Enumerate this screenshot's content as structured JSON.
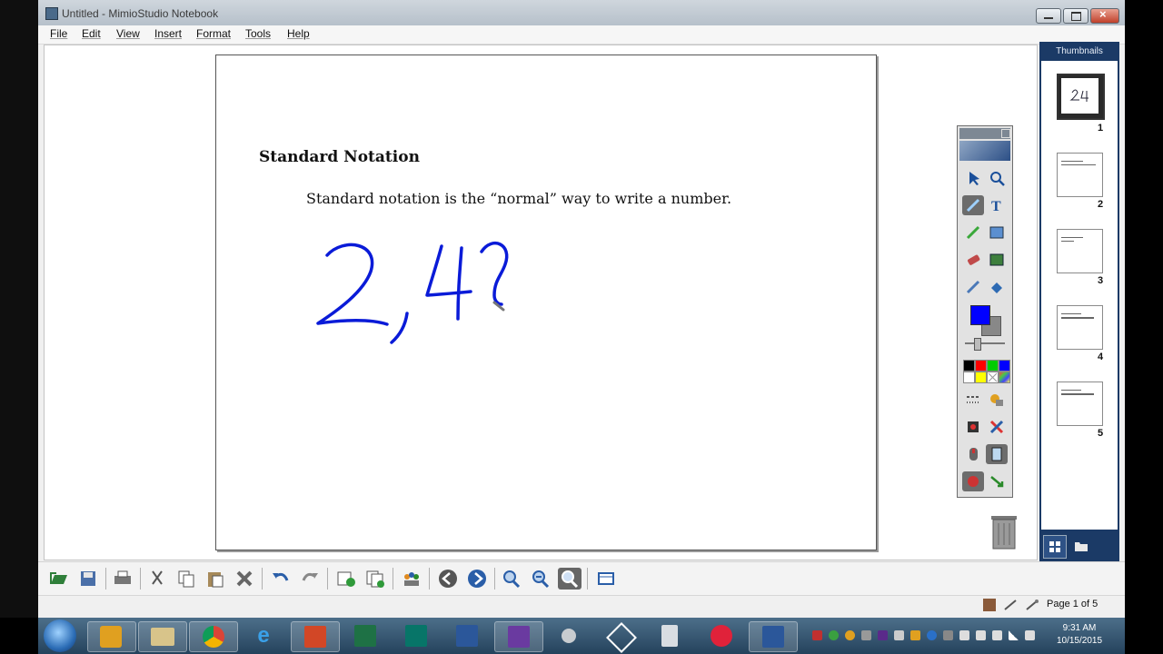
{
  "window": {
    "title": "Untitled - MimioStudio Notebook"
  },
  "menu": [
    "File",
    "Edit",
    "View",
    "Insert",
    "Format",
    "Tools",
    "Help"
  ],
  "page": {
    "heading": "Standard Notation",
    "body": "Standard notation is the “normal” way to write a number.",
    "handwriting": "2,4?"
  },
  "palette": {
    "current_color": "#0000ff",
    "swatches": [
      "#000000",
      "#ff0000",
      "#00cc00",
      "#0000ff",
      "#ffffff",
      "#ffff00",
      "#ffffff",
      "#cccccc"
    ],
    "tools": [
      "select-icon",
      "zoom-icon",
      "pen-icon",
      "text-icon",
      "highlighter-icon",
      "image-icon",
      "eraser-icon",
      "gallery-icon",
      "eyedropper-icon",
      "fill-icon",
      "line-style-icon",
      "shapes-icon",
      "record-icon",
      "delete-icon",
      "mouse-icon",
      "screen-icon",
      "reveal-icon",
      "arrow-tool-icon"
    ]
  },
  "thumbnails": {
    "header": "Thumbnails",
    "pages": [
      "1",
      "2",
      "3",
      "4",
      "5"
    ]
  },
  "toolbar": {
    "buttons": [
      "open-icon",
      "save-icon",
      "print-icon",
      "cut-icon",
      "copy-icon",
      "paste-icon",
      "delete-icon",
      "undo-icon",
      "redo-icon",
      "new-page-icon",
      "duplicate-page-icon",
      "collaborate-icon",
      "previous-page-icon",
      "next-page-icon",
      "zoom-in-icon",
      "zoom-out-icon",
      "fit-page-icon",
      "view-icon"
    ]
  },
  "status": {
    "page_indicator": "Page 1 of 5"
  },
  "taskbar": {
    "apps": [
      "outlook-icon",
      "file-explorer-icon",
      "chrome-icon",
      "internet-explorer-icon",
      "powerpoint-icon",
      "excel-icon",
      "publisher-icon",
      "word-icon",
      "mimio-icon",
      "app-icon",
      "mimio-tools-icon",
      "calculator-icon",
      "itunes-icon",
      "word-icon"
    ],
    "clock_time": "9:31 AM",
    "clock_date": "10/15/2015"
  }
}
